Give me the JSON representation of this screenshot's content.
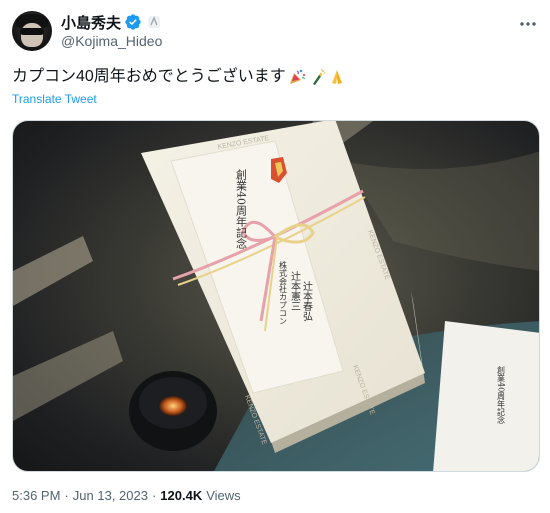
{
  "author": {
    "display_name": "小島秀夫",
    "handle": "@Kojima_Hideo",
    "avatar_icon": "avatar-photo",
    "verified_icon": "verified-badge-icon",
    "affiliation_icon": "affiliation-badge-icon"
  },
  "tweet": {
    "text": "カプコン40周年おめでとうございます",
    "emojis": [
      "party-popper-emoji",
      "champagne-emoji",
      "folded-hands-emoji"
    ],
    "translate_label": "Translate Tweet"
  },
  "media": {
    "description_icon": "photo-gift-box",
    "box_label_left": "創業40周年記念",
    "box_label_right_1": "株式会社カプコン",
    "box_label_right_2": "辻本憲三",
    "box_label_right_3": "辻本春弘",
    "wrap_brand": "KENZO ESTATE",
    "card_text": "創業40周年記念"
  },
  "footer": {
    "time": "5:36 PM",
    "date": "Jun 13, 2023",
    "separator": "·",
    "views_count": "120.4K",
    "views_label": "Views"
  },
  "colors": {
    "accent": "#1d9bf0",
    "secondary_text": "#536471",
    "primary_text": "#0f1419"
  }
}
